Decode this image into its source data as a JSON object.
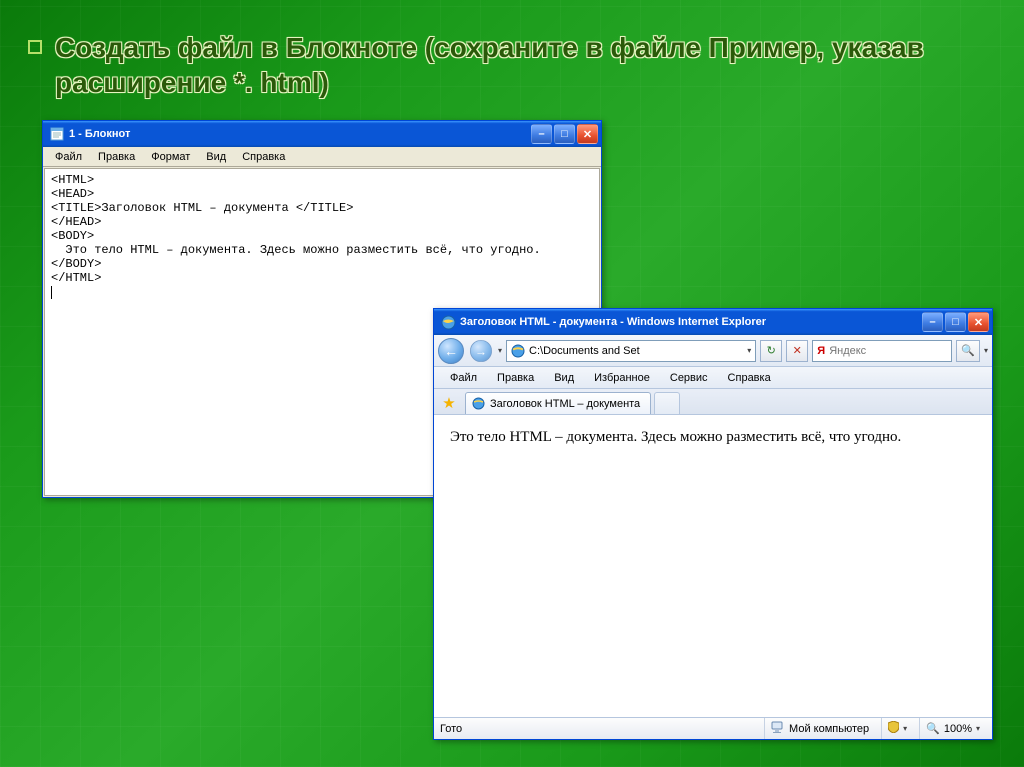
{
  "slide": {
    "title": "Создать файл в Блокноте (сохраните в файле Пример,  указав расширение  *. html)"
  },
  "notepad": {
    "title": "1 - Блокнот",
    "menu": {
      "file": "Файл",
      "edit": "Правка",
      "format": "Формат",
      "view": "Вид",
      "help": "Справка"
    },
    "content": "<HTML>\n<HEAD>\n<TITLE>Заголовок HTML – документа </TITLE>\n</HEAD>\n<BODY>\n  Это тело HTML – документа. Здесь можно разместить всё, что угодно.\n</BODY>\n</HTML>"
  },
  "ie": {
    "title": "Заголовок HTML - документа - Windows Internet Explorer",
    "address": "C:\\Documents and Set",
    "search_placeholder": "Яндекс",
    "search_prefix": "Я",
    "menu": {
      "file": "Файл",
      "edit": "Правка",
      "view": "Вид",
      "fav": "Избранное",
      "tools": "Сервис",
      "help": "Справка"
    },
    "tab_label": "Заголовок HTML – документа",
    "body_text": "Это тело HTML – документа. Здесь можно разместить всё, что угодно.",
    "status": {
      "ready": "Гото",
      "zone": "Мой компьютер",
      "zoom": "100%"
    }
  },
  "glyphs": {
    "min": "–",
    "max": "□",
    "close": "✕",
    "back": "←",
    "fwd": "→",
    "refresh": "↻",
    "stop": "✕",
    "dropdown": "▾",
    "search": "🔍",
    "star": "★"
  }
}
